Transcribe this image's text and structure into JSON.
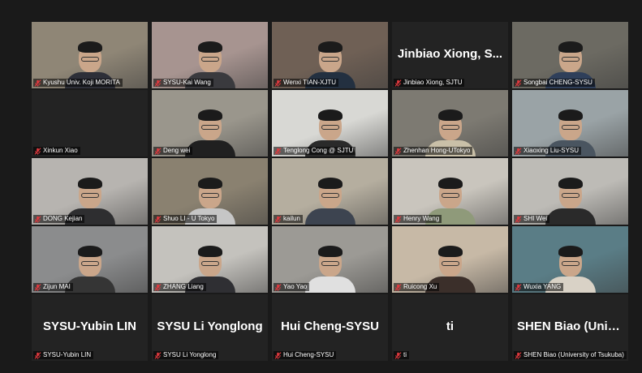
{
  "accent": "#c8e04a",
  "muted_icon_color": "#e0393e",
  "participants": [
    {
      "label": "Kyushu Univ. Koji MORITA",
      "video": true,
      "bg": "#8f8676",
      "shirt": "#2d2f38"
    },
    {
      "label": "SYSU-Kai Wang",
      "video": true,
      "active": true,
      "bg": "#a79490",
      "shirt": "#3a3a3e"
    },
    {
      "label": "Wenxi TIAN-XJTU",
      "video": true,
      "bg": "#6f6055",
      "shirt": "#233040"
    },
    {
      "label": "Jinbiao Xiong, SJTU",
      "video": false,
      "display": "Jinbiao Xiong, S..."
    },
    {
      "label": "Songbai CHENG-SYSU",
      "video": true,
      "bg": "#6c6a62",
      "shirt": "#2f3f5a"
    },
    {
      "label": "Xinkun Xiao",
      "video": false,
      "display": ""
    },
    {
      "label": "Deng wei",
      "video": true,
      "bg": "#9a968c",
      "shirt": "#202020"
    },
    {
      "label": "Tenglong Cong @ SJTU",
      "video": true,
      "bg": "#d8d8d4",
      "shirt": "#2a2a2a"
    },
    {
      "label": "Zhenhan Hong-UTokyo",
      "video": true,
      "bg": "#7d7a72",
      "shirt": "#c9c0a8"
    },
    {
      "label": "Xiaoxing Liu-SYSU",
      "video": true,
      "bg": "#9aa3a6",
      "shirt": "#4a5560"
    },
    {
      "label": "DONG Kejian",
      "video": true,
      "bg": "#b7b4b0",
      "shirt": "#2e2e30"
    },
    {
      "label": "Shuo LI - U Tokyo",
      "video": true,
      "bg": "#8a8170",
      "shirt": "#c6c6c6"
    },
    {
      "label": "kailun",
      "video": true,
      "bg": "#b5ae9f",
      "shirt": "#3d4450"
    },
    {
      "label": "Henry Wang",
      "video": true,
      "bg": "#c9c5bd",
      "shirt": "#8f9a7a"
    },
    {
      "label": "SHI Wei",
      "video": true,
      "bg": "#bdbbb6",
      "shirt": "#2a2a2a"
    },
    {
      "label": "Zijun MAI",
      "video": true,
      "bg": "#8b8c8d",
      "shirt": "#353535"
    },
    {
      "label": "ZHANG Liang",
      "video": true,
      "bg": "#c4c2bd",
      "shirt": "#2f2f33"
    },
    {
      "label": "Yao Yao",
      "video": true,
      "bg": "#9c9a95",
      "shirt": "#e0e0e0"
    },
    {
      "label": "Ruicong Xu",
      "video": true,
      "bg": "#c7b9a6",
      "shirt": "#3b2f2a"
    },
    {
      "label": "Wuxia YANG",
      "video": true,
      "bg": "#5a7d86",
      "shirt": "#d9d2c6"
    },
    {
      "label": "SYSU-Yubin LIN",
      "video": false,
      "display": "SYSU-Yubin LIN"
    },
    {
      "label": "SYSU Li Yonglong",
      "video": false,
      "display": "SYSU Li Yonglong"
    },
    {
      "label": "Hui Cheng-SYSU",
      "video": false,
      "display": "Hui Cheng-SYSU"
    },
    {
      "label": "ti",
      "video": false,
      "display": "ti"
    },
    {
      "label": "SHEN Biao (University of Tsukuba)",
      "video": false,
      "display": "SHEN Biao (Univ..."
    }
  ]
}
